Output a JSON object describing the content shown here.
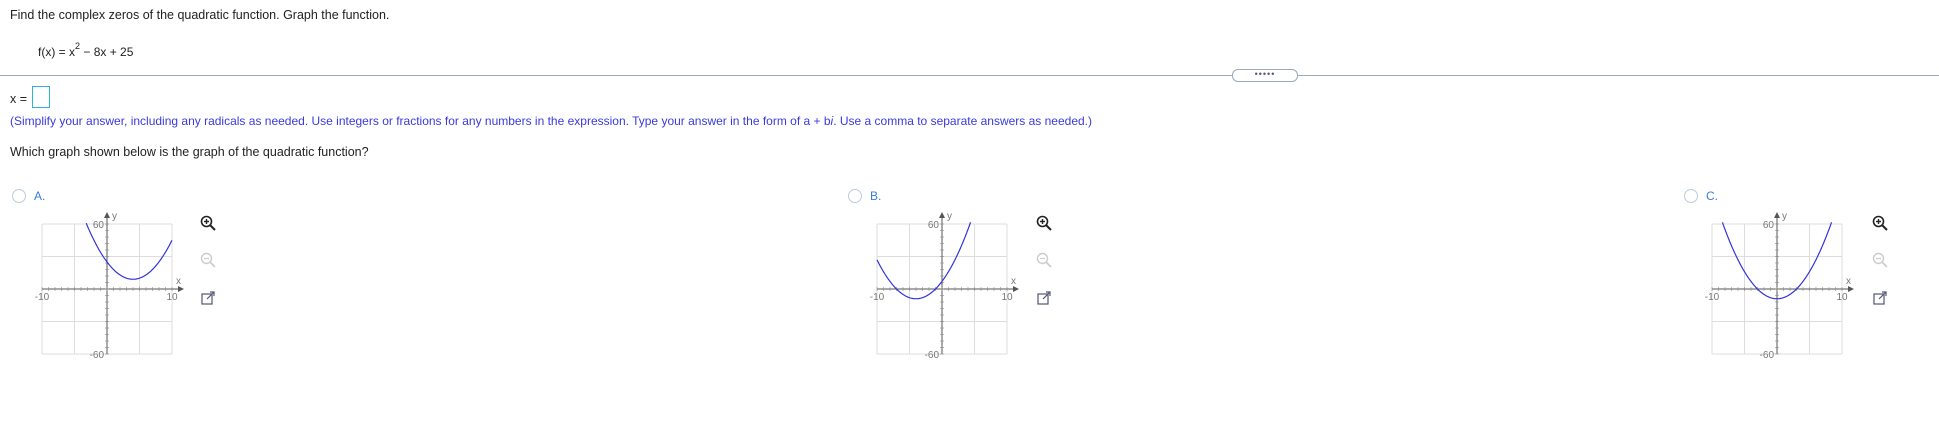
{
  "question": "Find the complex zeros of the quadratic function. Graph the function.",
  "function_parts": {
    "lhs": "f(x) = x",
    "exp": "2",
    "rhs": " − 8x + 25"
  },
  "answer": {
    "label": "x =",
    "value": "",
    "hint_before": "(Simplify your answer, including any radicals as needed. Use integers or fractions for any numbers in the expression. Type your answer in the form of a + b",
    "hint_i": "i",
    "hint_after": ". Use a comma to separate answers as needed.)"
  },
  "expander": "•••••",
  "which_question": "Which graph shown below is the graph of the quadratic function?",
  "options": [
    {
      "label": "A.",
      "selected": false
    },
    {
      "label": "B.",
      "selected": false
    },
    {
      "label": "C.",
      "selected": false
    }
  ],
  "graph_ticks": {
    "ymax": "60",
    "ymin": "-60",
    "xmin": "-10",
    "xmax": "10",
    "xaxis": "x",
    "yaxis": "y"
  },
  "colors": {
    "curve": "#3333dd",
    "grid": "#dddddd",
    "accent": "#2db3d9"
  },
  "icons": [
    "zoom-in-icon",
    "zoom-out-icon",
    "popout-icon"
  ],
  "chart_data": [
    {
      "type": "line",
      "option": "A",
      "function": "parabola",
      "vertex": [
        4,
        9
      ],
      "xlim": [
        -10,
        10
      ],
      "ylim": [
        -60,
        60
      ]
    },
    {
      "type": "line",
      "option": "B",
      "function": "parabola",
      "vertex": [
        -4,
        -9
      ],
      "xlim": [
        -10,
        10
      ],
      "ylim": [
        -60,
        60
      ]
    },
    {
      "type": "line",
      "option": "C",
      "function": "parabola",
      "vertex": [
        0,
        -9
      ],
      "xlim": [
        -10,
        10
      ],
      "ylim": [
        -60,
        60
      ]
    }
  ]
}
